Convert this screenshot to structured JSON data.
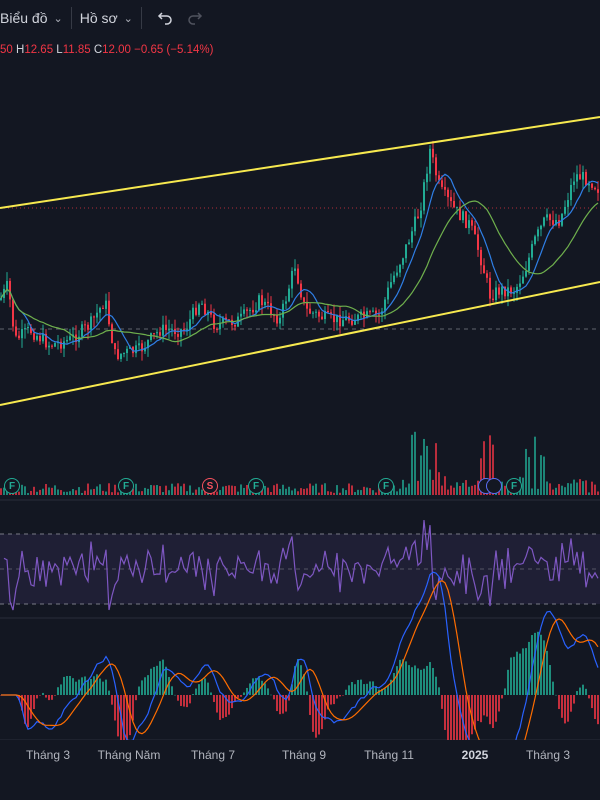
{
  "toolbar": {
    "chart_label": "Biểu đồ",
    "profile_label": "Hồ sơ",
    "icons": [
      "chevron-down-icon",
      "undo-icon",
      "redo-icon"
    ]
  },
  "legend": {
    "open_value": "50",
    "high_label": "H",
    "high_value": "12.65",
    "low_label": "L",
    "low_value": "11.85",
    "close_label": "C",
    "close_value": "12.00",
    "change": "−0.65 (−5.14%)"
  },
  "colors": {
    "up": "#22ab94",
    "down": "#f23645",
    "channel": "#f7e94f",
    "ma_fast": "#2f7fe6",
    "ma_slow": "#6fb04d",
    "rsi": "#7e57c2",
    "macd": "#2962ff",
    "signal": "#ff6d00"
  },
  "events": [
    {
      "label": "F",
      "kind": "dividend"
    },
    {
      "label": "F",
      "kind": "dividend"
    },
    {
      "label": "S",
      "kind": "split"
    },
    {
      "label": "F",
      "kind": "dividend"
    },
    {
      "label": "F",
      "kind": "dividend"
    },
    {
      "label": "",
      "kind": "other"
    },
    {
      "label": "",
      "kind": "other"
    },
    {
      "label": "F",
      "kind": "dividend"
    }
  ],
  "xaxis": {
    "labels": [
      {
        "text": "Tháng 3",
        "bold": false
      },
      {
        "text": "Tháng Năm",
        "bold": false
      },
      {
        "text": "Tháng 7",
        "bold": false
      },
      {
        "text": "Tháng 9",
        "bold": false
      },
      {
        "text": "Tháng 11",
        "bold": false
      },
      {
        "text": "2025",
        "bold": true
      },
      {
        "text": "Tháng 3",
        "bold": false
      }
    ]
  }
}
